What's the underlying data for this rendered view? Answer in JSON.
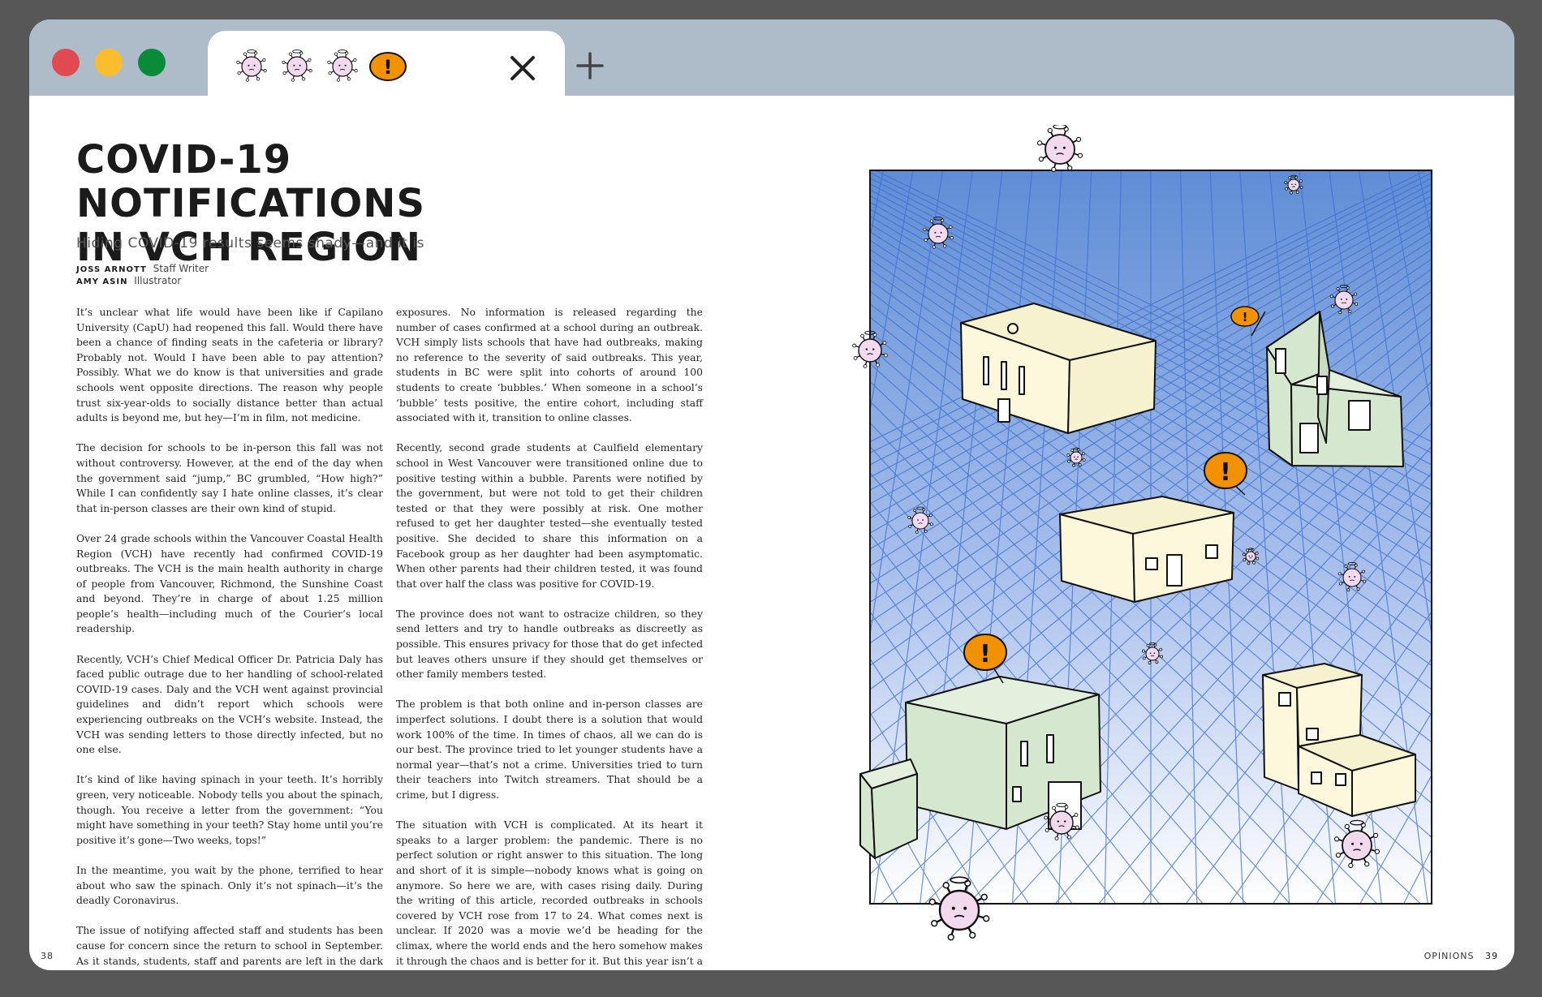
{
  "window": {
    "tab_icons": [
      "virus-icon",
      "virus-icon",
      "virus-icon",
      "alert-icon"
    ],
    "traffic_lights": [
      "#e14a50",
      "#fbbc2e",
      "#0a8b3a"
    ]
  },
  "article": {
    "title_line1": "COVID-19 NOTIFICATIONS",
    "title_line2": "IN VCH REGION",
    "subtitle": "Hiding COVID-19 results seems shady—and it is",
    "author_name": "JOSS ARNOTT",
    "author_role": "Staff Writer",
    "illustrator_name": "AMY ASIN",
    "illustrator_role": "Illustrator",
    "col1": [
      "It’s unclear what life would have been like if Capilano University (CapU) had reopened this fall. Would there have been a chance of finding seats in the cafeteria or library? Probably not. Would I have been able to pay attention? Possibly. What we do know is that universities and grade schools went opposite directions. The reason why people trust six-year-olds to socially distance better than actual adults is beyond me, but hey—I’m in film, not medicine.",
      "The decision for schools to be in-person this fall was not without controversy. However, at the end of the day when the government said “jump,” BC grumbled, “How high?” While I can confidently say I hate online classes, it’s clear that in-person classes are their own kind of stupid.",
      "Over 24 grade schools within the Vancouver Coastal Health Region (VCH) have recently had confirmed COVID-19 outbreaks. The VCH is the main health authority in charge of people from Vancouver, Richmond, the Sunshine Coast and beyond. They’re in charge of about 1.25 million people’s health—including much of the Courier’s local readership.",
      "Recently, VCH’s Chief Medical Officer Dr. Patricia Daly has faced public outrage due to her handling of school-related COVID-19 cases. Daly and the VCH went against provincial guidelines and didn’t report which schools were experiencing outbreaks on the VCH’s website. Instead, the VCH was sending letters to those directly infected, but no one else.",
      "It’s kind of like having spinach in your teeth. It’s horribly green, very noticeable. Nobody tells you about the spinach, though. You receive a letter from the government: “You might have something in your teeth? Stay home until you’re positive it’s gone—Two weeks, tops!”",
      "In the meantime, you wait by the phone, terrified to hear about who saw the spinach. Only it’s not spinach—it’s the deadly Coronavirus.",
      "The issue of notifying affected staff and students has been cause for concern since the return to school in September. As it stands, students, staff and parents are left in the dark about possible"
    ],
    "col2": [
      "exposures. No information is released regarding the number of cases confirmed at a school during an outbreak. VCH simply lists schools that have had outbreaks, making no reference to the severity of said outbreaks. This year, students in BC were split into cohorts of around 100 students to create ‘bubbles.’ When someone in a school’s ‘bubble’ tests positive, the entire cohort, including staff associated with it, transition to online classes.",
      "Recently, second grade students at Caulfield elementary school in West Vancouver were transitioned online due to positive testing within a bubble. Parents were notified by the government, but were not told to get their children tested or that they were possibly at risk. One mother refused to get her daughter tested—she eventually tested positive. She decided to share this information on a Facebook group as her daughter had been asymptomatic. When other parents had their children tested, it was found that over half the class was positive for COVID-19.",
      "The province does not want to ostracize children, so they send letters and try to handle outbreaks as discreetly as possible. This ensures privacy for those that do get infected but leaves others unsure if they should get themselves or other family members tested.",
      "The problem is that both online and in-person classes are imperfect solutions. I doubt there is a solution that would work 100% of the time. In times of chaos, all we can do is our best. The province tried to let younger students have a normal year—that’s not a crime. Universities tried to turn their teachers into Twitch streamers. That should be a crime, but I digress.",
      "The situation with VCH is complicated. At its heart it speaks to a larger problem: the pandemic. There is no perfect solution or right answer to this situation. The long and short of it is simple—nobody knows what is going on anymore. So here we are, with cases rising daily. During the writing of this article, recorded outbreaks in schools covered by VCH rose from 17 to 24. What comes next is unclear. If 2020 was a movie we’d be heading for the climax, where the world ends and the hero somehow makes it through the chaos and is better for it. But this year isn’t a movie—it’s just screwed."
    ]
  },
  "folio": {
    "left_page": "38",
    "section": "OPINIONS",
    "right_page": "39"
  },
  "illustration": {
    "alert_mark": "!",
    "colors": {
      "sky_top": "#5f8dd6",
      "sky_bottom": "#ffffff",
      "grid": "#3d6fd0",
      "building_cream": "#fdf8dc",
      "building_green": "#d5e8cf",
      "alert": "#f39200",
      "virus": "#f3d9ee"
    }
  }
}
